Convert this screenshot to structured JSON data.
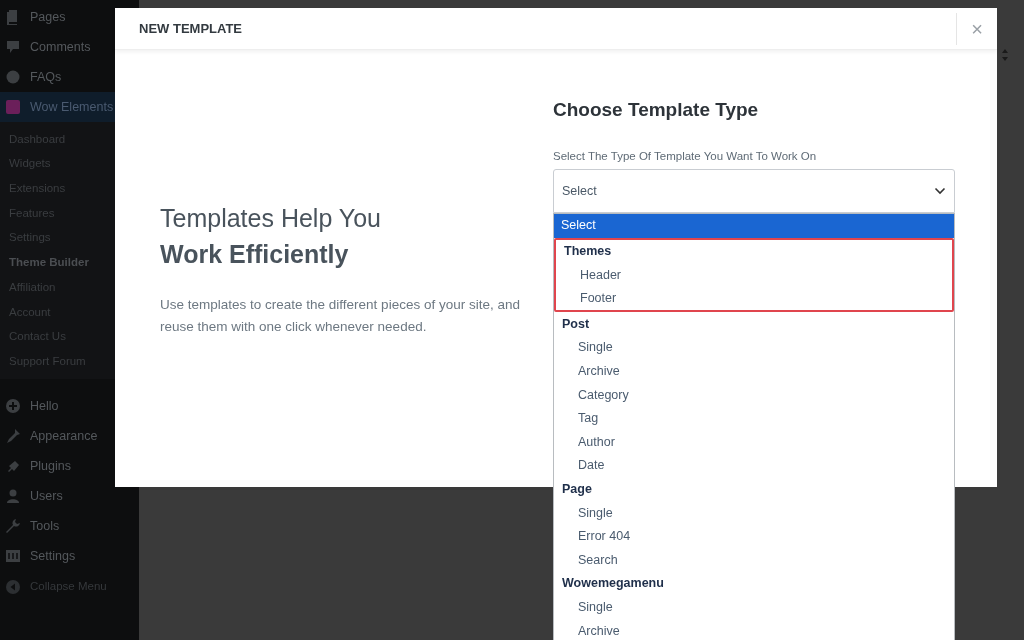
{
  "sidebar": {
    "top_items": [
      {
        "label": "Pages",
        "selected": false
      },
      {
        "label": "Comments",
        "selected": false
      },
      {
        "label": "FAQs",
        "selected": false
      },
      {
        "label": "Wow Elements",
        "selected": true
      }
    ],
    "submenu": [
      {
        "label": "Dashboard",
        "selected": false
      },
      {
        "label": "Widgets",
        "selected": false
      },
      {
        "label": "Extensions",
        "selected": false
      },
      {
        "label": "Features",
        "selected": false
      },
      {
        "label": "Settings",
        "selected": false
      },
      {
        "label": "Theme Builder",
        "selected": true
      },
      {
        "label": "Affiliation",
        "selected": false
      },
      {
        "label": "Account",
        "selected": false
      },
      {
        "label": "Contact Us",
        "selected": false
      },
      {
        "label": "Support Forum",
        "selected": false
      }
    ],
    "bottom_items": [
      {
        "label": "Hello"
      },
      {
        "label": "Appearance"
      },
      {
        "label": "Plugins"
      },
      {
        "label": "Users"
      },
      {
        "label": "Tools"
      },
      {
        "label": "Settings"
      }
    ],
    "collapse": "Collapse Menu"
  },
  "modal": {
    "title": "NEW TEMPLATE",
    "close": "×",
    "headline": "Templates Help You",
    "headline_bold": "Work Efficiently",
    "description": "Use templates to create the different pieces of your site, and reuse them with one click whenever needed.",
    "form_title": "Choose Template Type",
    "field_label": "Select The Type Of Template You Want To Work On",
    "select": {
      "value": "Select",
      "expanded": true,
      "options": [
        {
          "kind": "option",
          "label": "Select",
          "selected": true
        },
        {
          "kind": "group",
          "label": "Themes",
          "highlighted": true,
          "children": [
            {
              "label": "Header",
              "selected": false
            },
            {
              "label": "Footer",
              "selected": false
            }
          ]
        },
        {
          "kind": "group",
          "label": "Post",
          "highlighted": false,
          "children": [
            {
              "label": "Single",
              "selected": false
            },
            {
              "label": "Archive",
              "selected": false
            },
            {
              "label": "Category",
              "selected": false
            },
            {
              "label": "Tag",
              "selected": false
            },
            {
              "label": "Author",
              "selected": false
            },
            {
              "label": "Date",
              "selected": false
            }
          ]
        },
        {
          "kind": "group",
          "label": "Page",
          "highlighted": false,
          "children": [
            {
              "label": "Single",
              "selected": false
            },
            {
              "label": "Error 404",
              "selected": false
            },
            {
              "label": "Search",
              "selected": false
            }
          ]
        },
        {
          "kind": "group",
          "label": "Wowemegamenu",
          "highlighted": false,
          "children": [
            {
              "label": "Single",
              "selected": false
            },
            {
              "label": "Archive",
              "selected": false
            }
          ]
        }
      ]
    }
  }
}
